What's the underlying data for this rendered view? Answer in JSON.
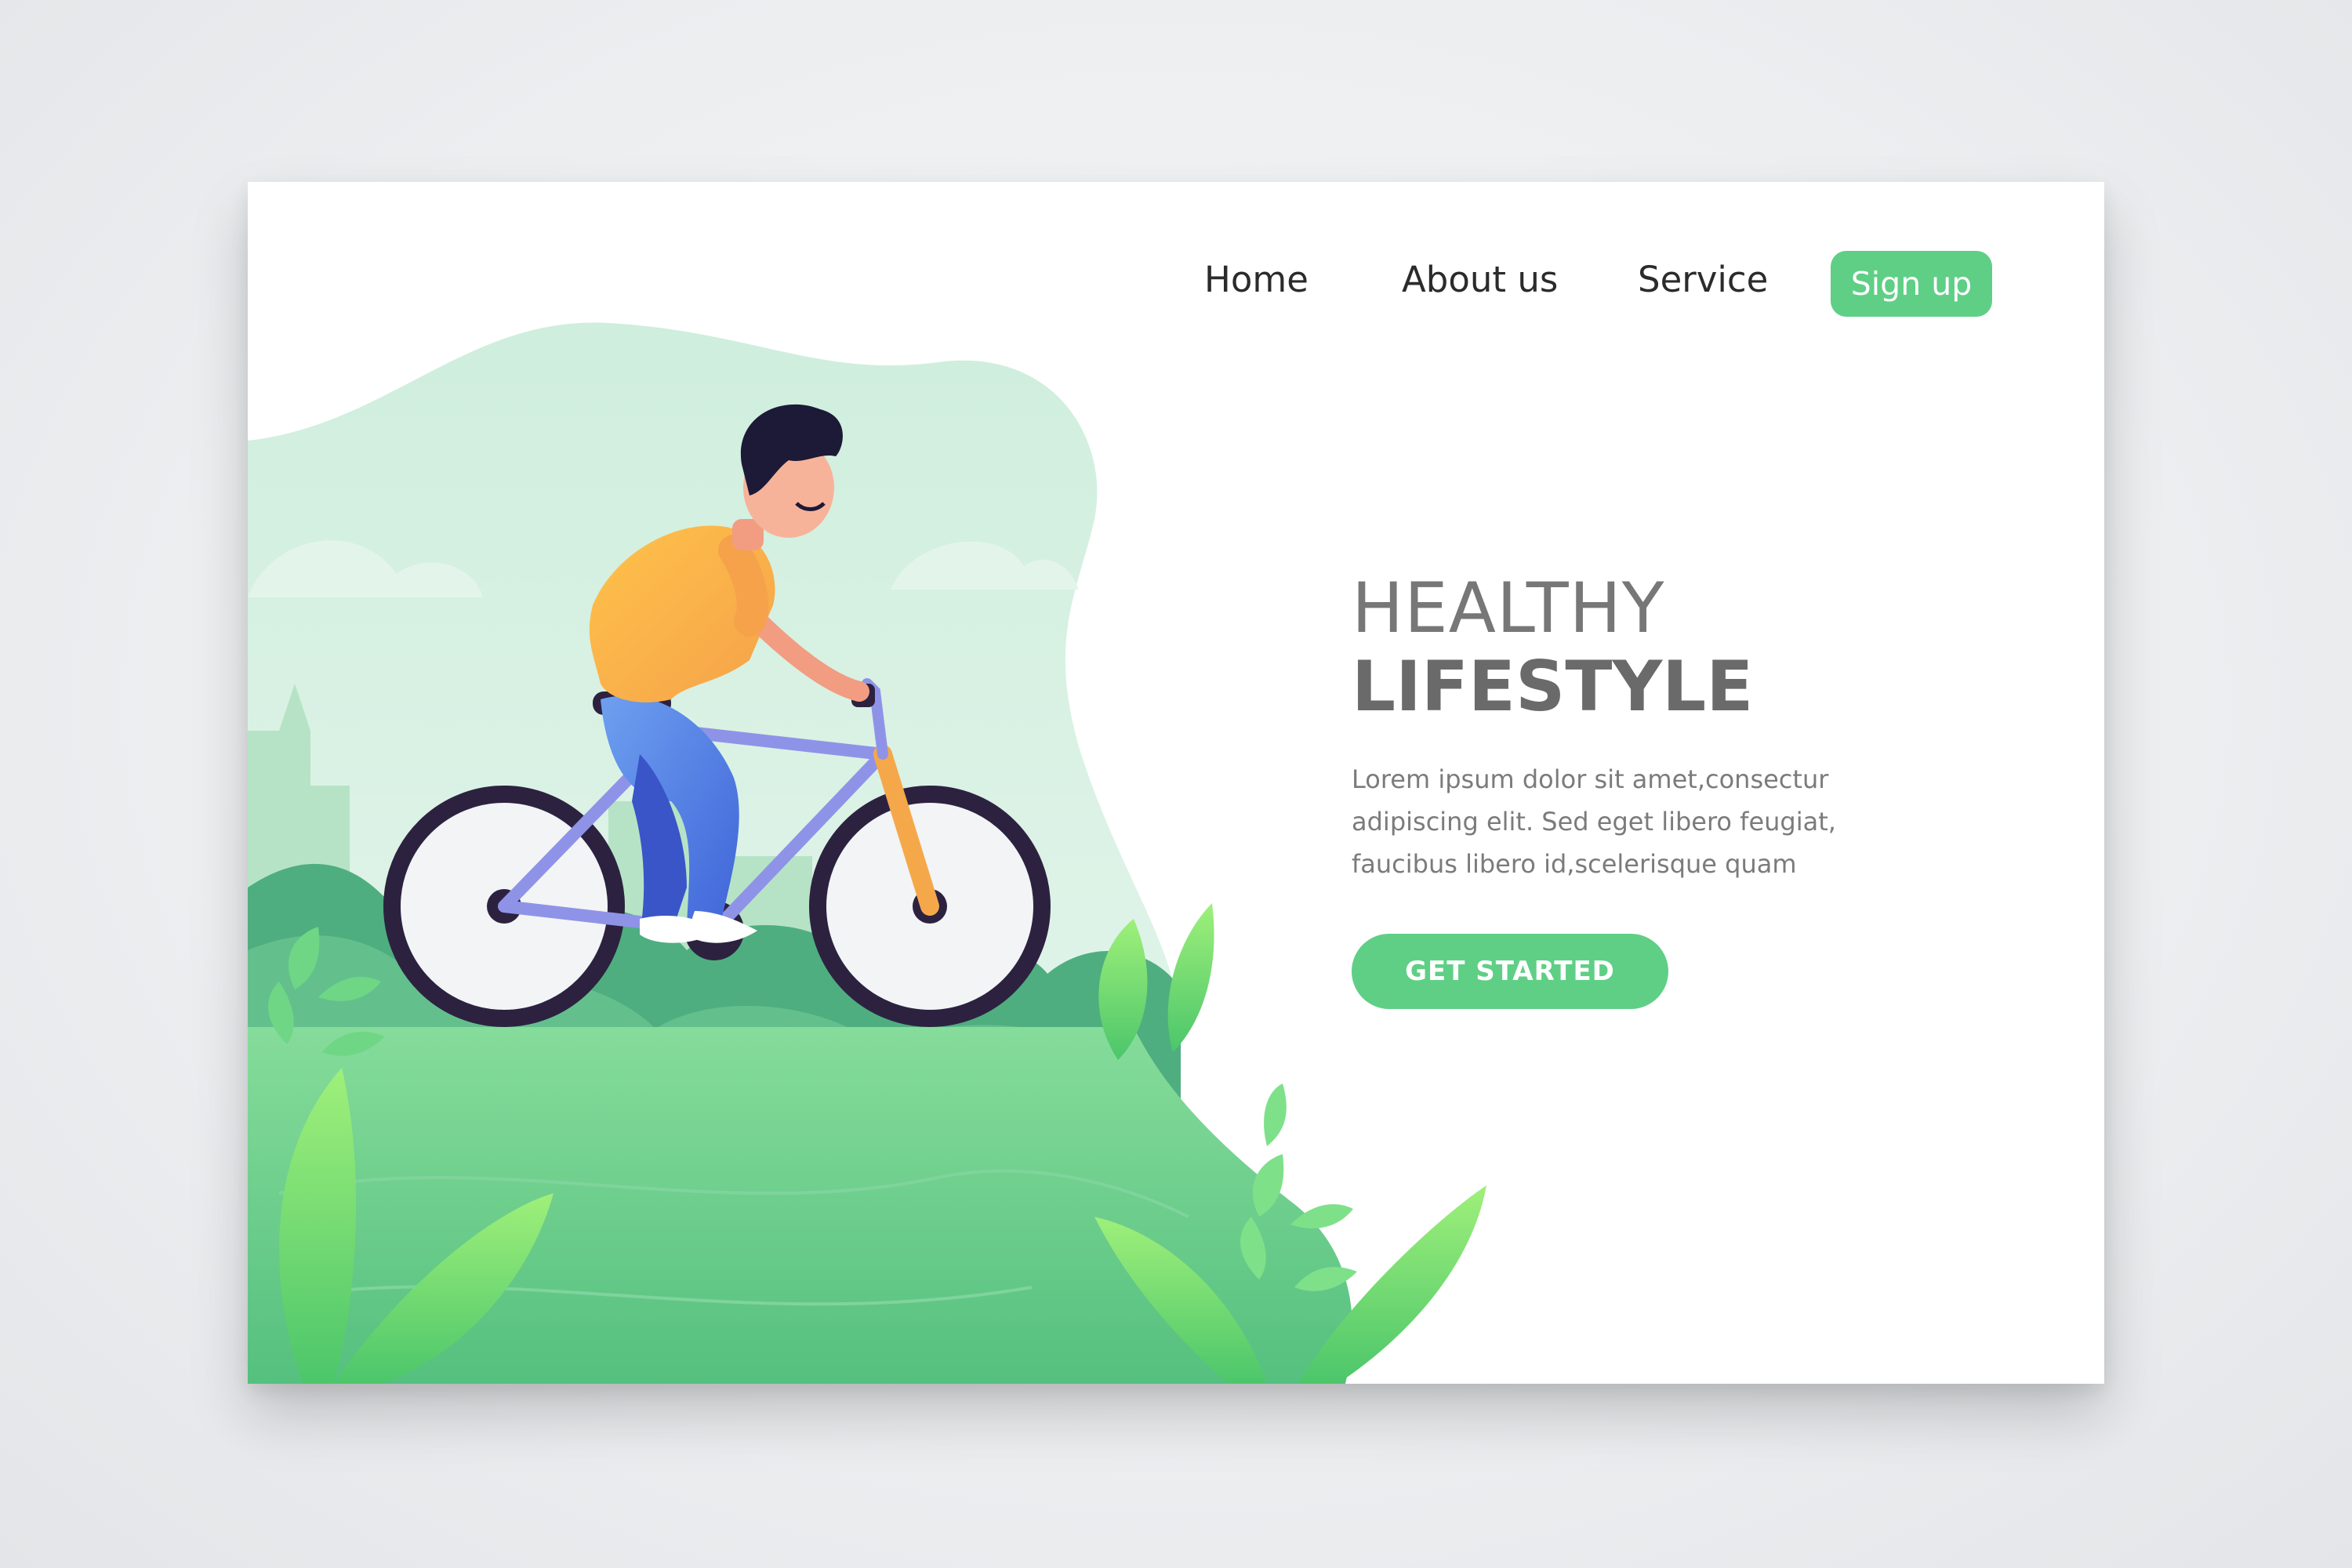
{
  "nav": {
    "items": [
      {
        "label": "Home"
      },
      {
        "label": "About us"
      },
      {
        "label": "Service"
      }
    ],
    "signup_label": "Sign up"
  },
  "hero": {
    "title_line1": "HEALTHY",
    "title_line2": "LIFESTYLE",
    "body": "Lorem ipsum dolor sit amet,consectur adipiscing elit. Sed eget libero feugiat, faucibus libero id,scelerisque quam",
    "cta_label": "GET STARTED"
  },
  "colors": {
    "accent": "#5fcf86",
    "title_text": "#6e6e6e",
    "body_text": "#7b7b7b",
    "nav_text": "#2b2b2b"
  },
  "icons": [
    "cyclist-illustration",
    "bicycle-icon",
    "leaf-icon"
  ]
}
